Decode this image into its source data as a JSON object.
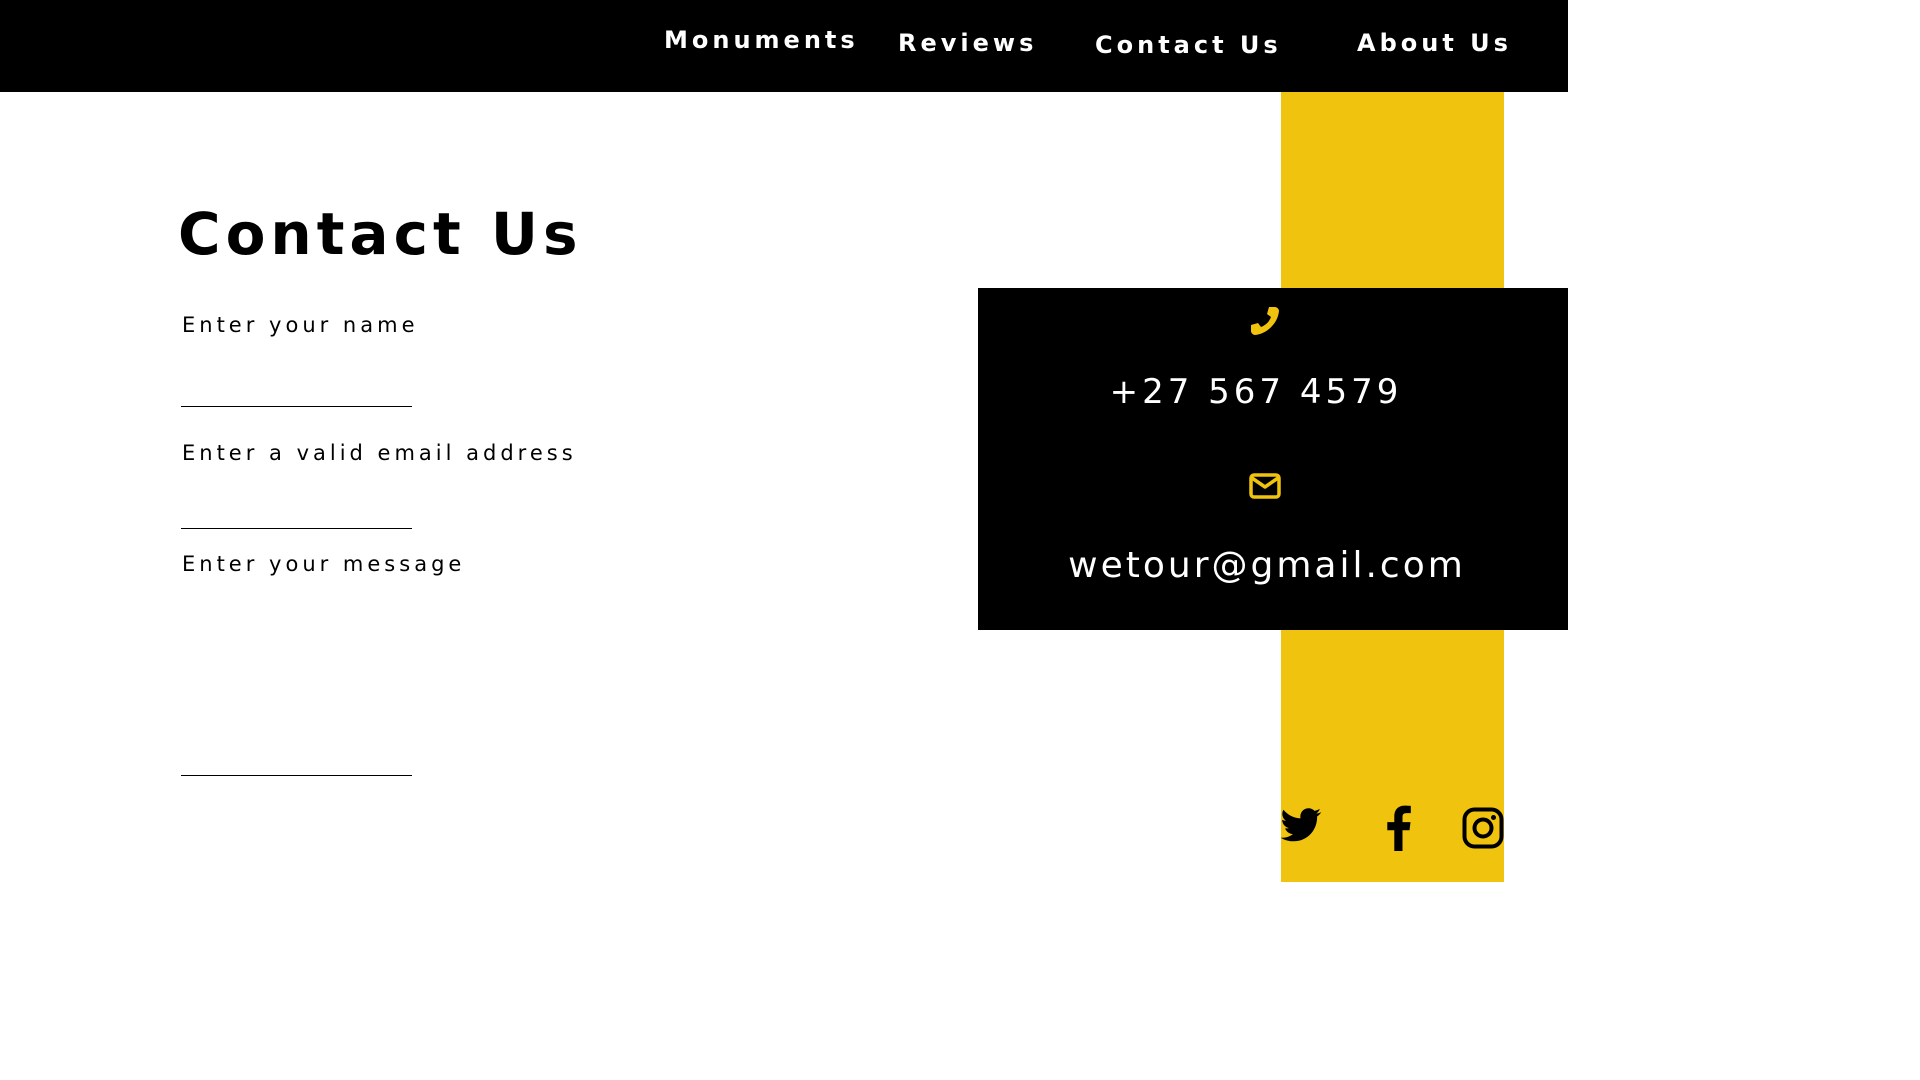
{
  "nav": {
    "items": [
      {
        "label": "Monuments"
      },
      {
        "label": "Reviews"
      },
      {
        "label": "Contact Us"
      },
      {
        "label": "About Us"
      }
    ]
  },
  "form": {
    "title": "Contact Us",
    "name_label": "Enter your name",
    "name_value": "",
    "email_label": "Enter a valid email address",
    "email_value": "",
    "message_label": "Enter your message",
    "message_value": ""
  },
  "contact_info": {
    "phone_icon": "phone-icon",
    "phone": "+27 567 4579",
    "email_icon": "envelope-icon",
    "email": "wetour@gmail.com"
  },
  "social": {
    "icons": [
      "twitter-icon",
      "facebook-icon",
      "instagram-icon"
    ]
  },
  "colors": {
    "accent": "#f0c30f",
    "nav_background": "#000000",
    "info_background": "#000000",
    "text_light": "#ffffff"
  }
}
